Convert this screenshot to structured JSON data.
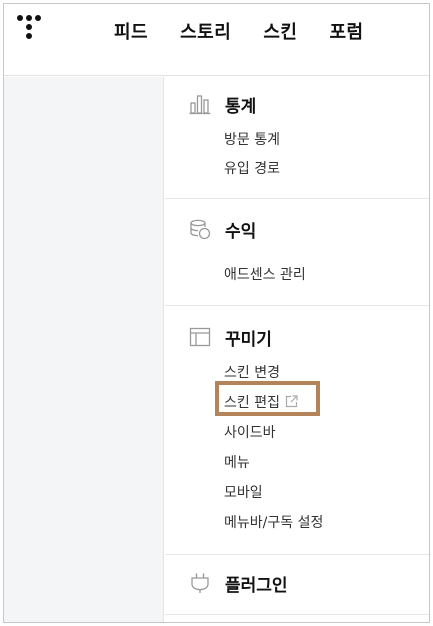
{
  "nav": {
    "items": [
      "피드",
      "스토리",
      "스킨",
      "포럼"
    ]
  },
  "sections": [
    {
      "title": "통계",
      "icon": "bar-chart-icon",
      "items": [
        "방문 통계",
        "유입 경로"
      ]
    },
    {
      "title": "수익",
      "icon": "coins-icon",
      "items": [
        "애드센스 관리"
      ]
    },
    {
      "title": "꾸미기",
      "icon": "layout-icon",
      "items": [
        "스킨 변경",
        "스킨 편집",
        "사이드바",
        "메뉴",
        "모바일",
        "메뉴바/구독 설정"
      ]
    },
    {
      "title": "플러그인",
      "icon": "plug-icon",
      "items": []
    }
  ],
  "colors": {
    "highlight_border": "#b3835a",
    "left_pane": "#f3f5f7"
  }
}
